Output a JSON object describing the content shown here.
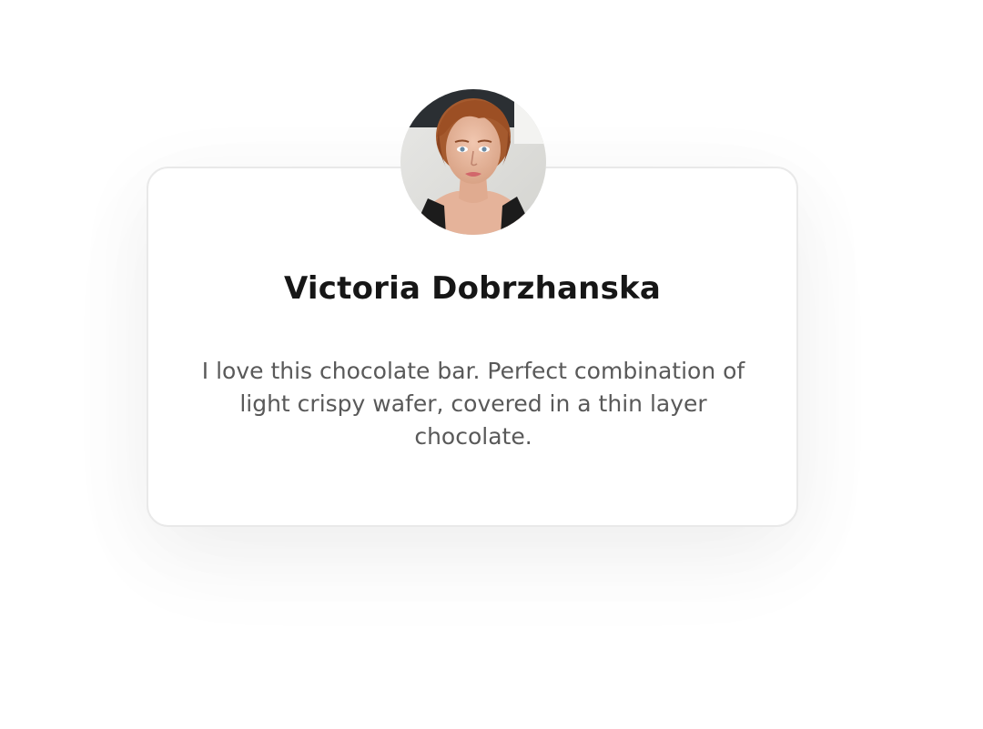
{
  "testimonial": {
    "name": "Victoria Dobrzhanska",
    "quote": "I love this chocolate bar. Perfect combination of light crispy wafer, covered in a thin layer chocolate.",
    "avatar_icon": "person-photo"
  },
  "colors": {
    "name_text": "#161616",
    "quote_text": "#595959",
    "card_border": "#e9e9e9",
    "page_background": "#ffffff"
  }
}
